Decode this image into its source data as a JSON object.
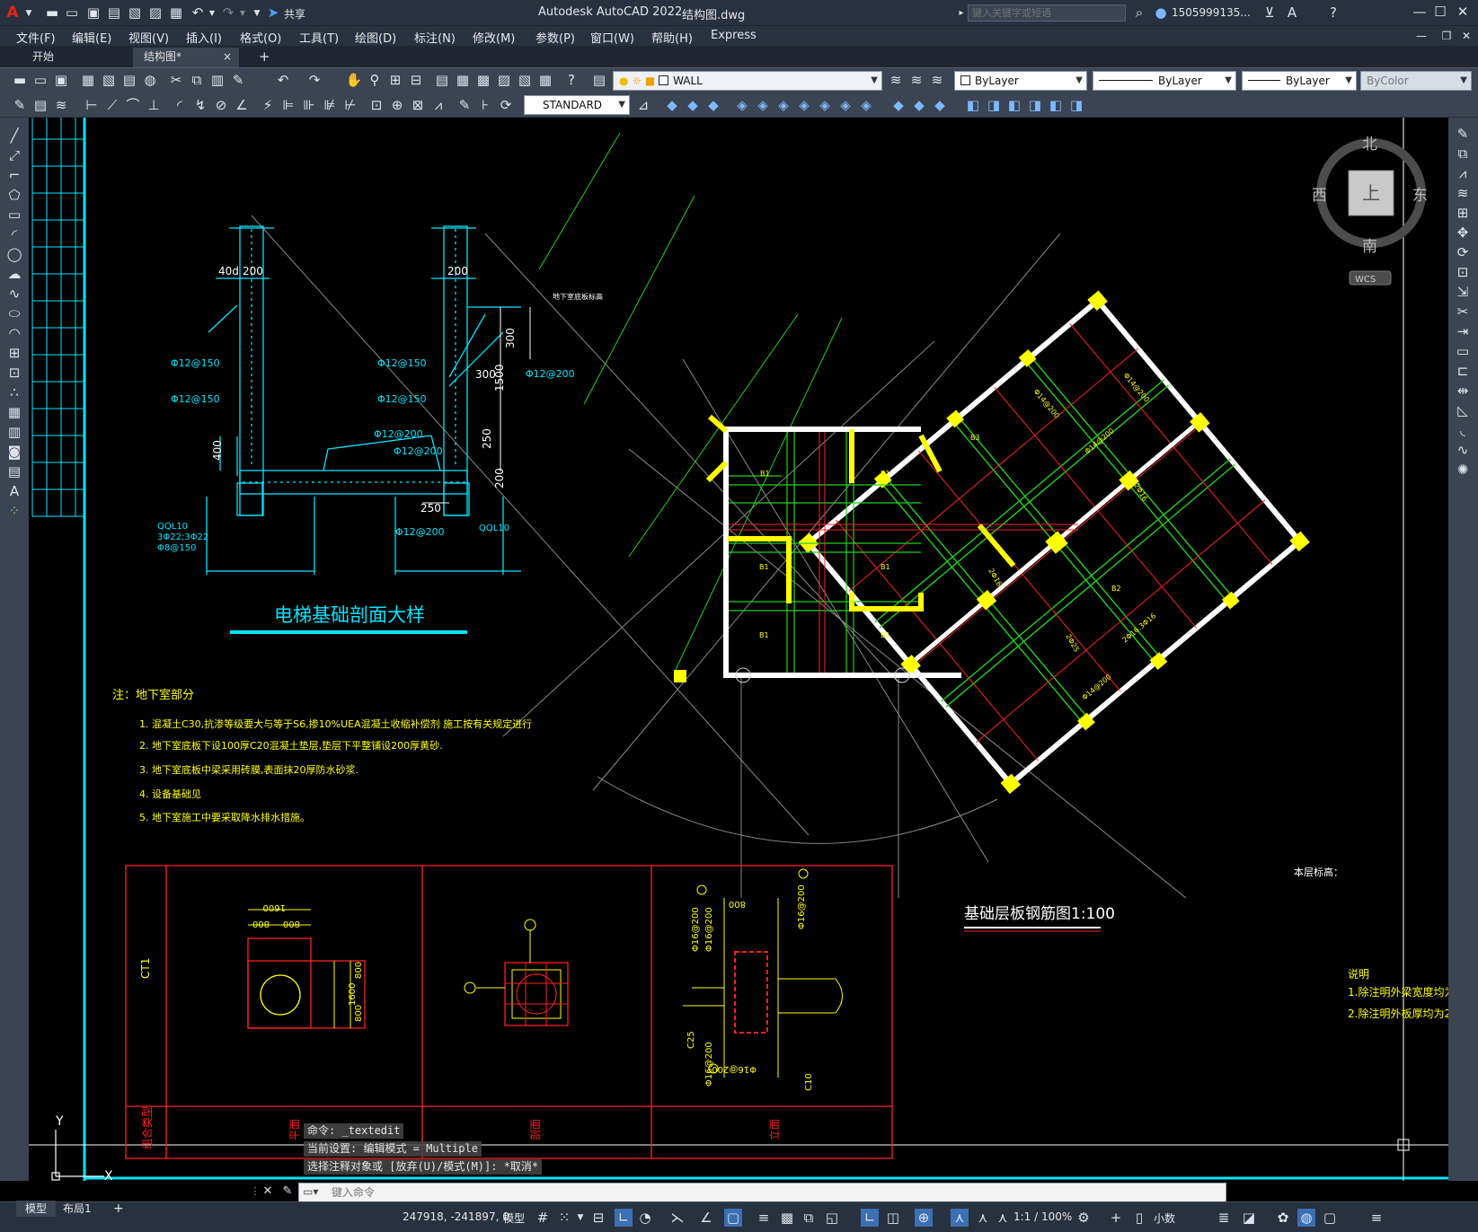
{
  "app": {
    "title": "Autodesk AutoCAD 2022",
    "filename": "结构图.dwg",
    "share_label": "共享",
    "search_placeholder": "键入关键字或短语",
    "user": "1505999135..."
  },
  "menu": [
    "文件(F)",
    "编辑(E)",
    "视图(V)",
    "插入(I)",
    "格式(O)",
    "工具(T)",
    "绘图(D)",
    "标注(N)",
    "修改(M)",
    "参数(P)",
    "窗口(W)",
    "帮助(H)",
    "Express"
  ],
  "tabs": {
    "start": "开始",
    "drawing": "结构图*",
    "close": "×",
    "add": "+"
  },
  "toolbar": {
    "layer": "WALL",
    "color": "ByLayer",
    "linetype": "ByLayer",
    "lineweight": "ByLayer",
    "plotstyle": "ByColor",
    "textstyle": "STANDARD"
  },
  "viewcube": {
    "north": "北",
    "south": "南",
    "east": "东",
    "west": "西",
    "top": "上",
    "wcs": "WCS"
  },
  "drawing": {
    "section_title": "电梯基础剖面大样",
    "plan_title": "基础层板钢筋图1:100",
    "elev_label": "本层标高：",
    "dims": {
      "d40d": "40d",
      "d200a": "200",
      "d200b": "200",
      "d300a": "300",
      "d300b": "300",
      "d1500": "1500",
      "d250a": "250",
      "d200c": "200",
      "d400": "400",
      "d250b": "250"
    },
    "rebar": {
      "r1": "Φ12@150",
      "r2": "Φ12@150",
      "r3": "Φ12@150",
      "r4": "Φ12@150",
      "r5": "Φ12@200",
      "r6": "Φ12@200",
      "r7": "Φ12@200",
      "r8": "Φ12@200",
      "qql1": "QQL10",
      "qql1b": "3Φ22;3Φ22",
      "qql1c": "Φ8@150",
      "qql2": "QQL10",
      "slab_mark": "地下室底板标高"
    },
    "notes_heading": "注：地下室部分",
    "notes": [
      "1. 混凝土C30,抗渗等级要大与等于S6,掺10%UEA混凝土收缩补偿剂 施工按有关规定进行",
      "2. 地下室底板下设100厚C20混凝土垫层,垫层下平整铺设200厚黄砂.",
      "3. 地下室底板中梁采用砖膜,表面抹20厚防水砂浆.",
      "4. 设备基础见",
      "5. 地下室施工中要采取降水排水措施。"
    ],
    "explain_heading": "说明",
    "explain": [
      "1.除注明外梁宽度均为6Φ8",
      "2.除注明外板厚均为250."
    ],
    "table": {
      "col1": "CT1",
      "d1600": "1600",
      "d800a": "800",
      "d800b": "800",
      "d800c": "800",
      "d800d": "800",
      "d1600b": "1600",
      "bottom1": "组合类型",
      "bottom2": "平面",
      "bottom3": "剖面",
      "bottom4": "立面",
      "c25": "C25",
      "c10": "C10",
      "r16a": "Φ16@200",
      "r16b": "Φ16@200",
      "r16c": "Φ16@200",
      "r16d": "Φ16@200",
      "d800e": "800",
      "r16e": "Φ16@200"
    },
    "plan_labels": [
      "Φ14@200",
      "Φ14@200",
      "Φ14@200",
      "Φ14@200",
      "2Φ16",
      "2Φ16",
      "2Φ25",
      "2Φ16.3Φ16",
      "B1",
      "B3",
      "B2"
    ]
  },
  "command": {
    "line1": "命令: _textedit",
    "line2": "当前设置: 编辑模式 = Multiple",
    "line3": "选择注释对象或 [放弃(U)/模式(M)]: *取消*",
    "placeholder": "键入命令"
  },
  "layout_tabs": {
    "model": "模型",
    "layout1": "布局1",
    "add": "+"
  },
  "status": {
    "coords": "247918, -241897, 0",
    "space": "模型",
    "scale": "1:1 / 100%",
    "units": "小数"
  },
  "ucs": {
    "x": "X",
    "y": "Y"
  }
}
